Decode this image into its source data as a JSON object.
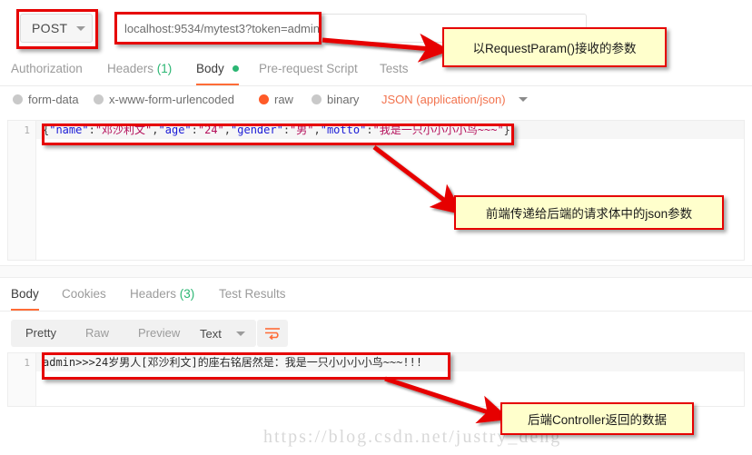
{
  "request": {
    "method": "POST",
    "url": "localhost:9534/mytest3?token=admin",
    "tabs": [
      {
        "label": "Authorization",
        "active": false
      },
      {
        "label": "Headers",
        "count": "(1)",
        "active": false
      },
      {
        "label": "Body",
        "active": true,
        "dot": true
      },
      {
        "label": "Pre-request Script",
        "active": false
      },
      {
        "label": "Tests",
        "active": false
      }
    ],
    "body_types": [
      {
        "label": "form-data",
        "selected": false
      },
      {
        "label": "x-www-form-urlencoded",
        "selected": false
      },
      {
        "label": "raw",
        "selected": true
      },
      {
        "label": "binary",
        "selected": false
      }
    ],
    "content_type": "JSON (application/json)",
    "editor": {
      "line_number": "1",
      "tokens": [
        {
          "t": "{",
          "k": "punct"
        },
        {
          "t": "\"name\"",
          "k": "key"
        },
        {
          "t": ":",
          "k": "punct"
        },
        {
          "t": "\"邓沙利文\"",
          "k": "str"
        },
        {
          "t": ",",
          "k": "punct"
        },
        {
          "t": "\"age\"",
          "k": "key"
        },
        {
          "t": ":",
          "k": "punct"
        },
        {
          "t": "\"24\"",
          "k": "str"
        },
        {
          "t": ",",
          "k": "punct"
        },
        {
          "t": "\"gender\"",
          "k": "key"
        },
        {
          "t": ":",
          "k": "punct"
        },
        {
          "t": "\"男\"",
          "k": "str"
        },
        {
          "t": ",",
          "k": "punct"
        },
        {
          "t": "\"motto\"",
          "k": "key"
        },
        {
          "t": ":",
          "k": "punct"
        },
        {
          "t": "\"我是一只小小小小鸟~~~\"",
          "k": "str"
        },
        {
          "t": "}",
          "k": "punct"
        }
      ],
      "raw_text": "{\"name\":\"邓沙利文\",\"age\":\"24\",\"gender\":\"男\",\"motto\":\"我是一只小小小小鸟~~~\"}"
    }
  },
  "response": {
    "tabs": [
      {
        "label": "Body",
        "active": true
      },
      {
        "label": "Cookies",
        "active": false
      },
      {
        "label": "Headers",
        "count": "(3)",
        "active": false
      },
      {
        "label": "Test Results",
        "active": false
      }
    ],
    "view_modes": [
      {
        "label": "Pretty",
        "active": true
      },
      {
        "label": "Raw",
        "active": false
      },
      {
        "label": "Preview",
        "active": false
      }
    ],
    "format": "Text",
    "wrap_icon": "wrap-lines-icon",
    "editor": {
      "line_number": "1",
      "text": "admin>>>24岁男人[邓沙利文]的座右铭居然是：我是一只小小小小鸟~~~!!!"
    }
  },
  "annotations": [
    {
      "id": "param-note",
      "text": "以RequestParam()接收的参数"
    },
    {
      "id": "json-body-note",
      "text": "前端传递给后端的请求体中的json参数"
    },
    {
      "id": "controller-note",
      "text": "后端Controller返回的数据"
    }
  ],
  "watermark": "https://blog.csdn.net/justry_deng",
  "colors": {
    "accent": "#ff6c37",
    "callout_bg": "#ffffcc",
    "callout_border": "#e60000",
    "green": "#2bb673",
    "json_key": "#1a1ad6",
    "json_string": "#b5105b"
  }
}
